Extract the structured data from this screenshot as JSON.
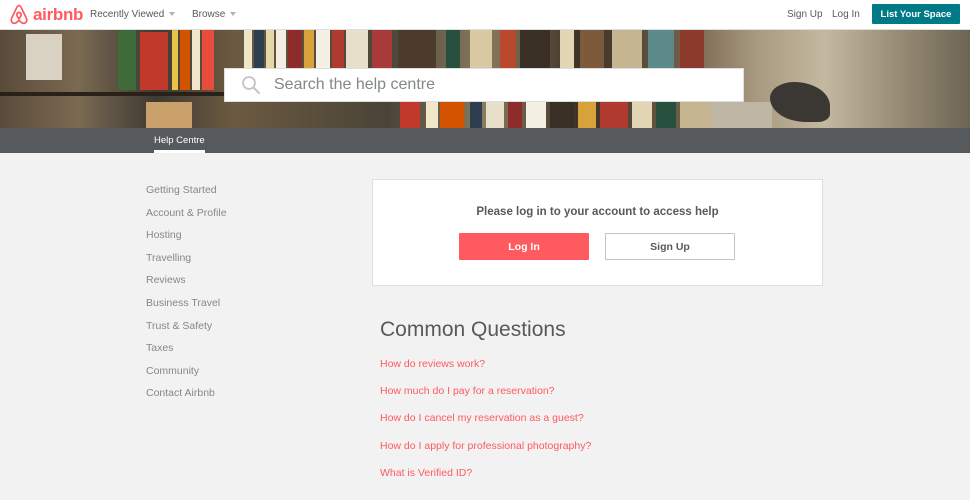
{
  "brand": {
    "name": "airbnb",
    "color": "#ff5a5f"
  },
  "header": {
    "recently_viewed": "Recently Viewed",
    "browse": "Browse",
    "sign_up": "Sign Up",
    "log_in": "Log In",
    "list_space": "List Your Space",
    "accent": "#007a87"
  },
  "search": {
    "placeholder": "Search the help centre",
    "icon": "search-icon"
  },
  "subnav": {
    "tab": "Help Centre"
  },
  "sidebar": {
    "items": [
      {
        "label": "Getting Started"
      },
      {
        "label": "Account & Profile"
      },
      {
        "label": "Hosting"
      },
      {
        "label": "Travelling"
      },
      {
        "label": "Reviews"
      },
      {
        "label": "Business Travel"
      },
      {
        "label": "Trust & Safety"
      },
      {
        "label": "Taxes"
      },
      {
        "label": "Community"
      },
      {
        "label": "Contact Airbnb"
      }
    ]
  },
  "login_card": {
    "message": "Please log in to your account to access help",
    "log_in": "Log In",
    "sign_up": "Sign Up"
  },
  "common_questions": {
    "title": "Common Questions",
    "items": [
      {
        "label": "How do reviews work?"
      },
      {
        "label": "How much do I pay for a reservation?"
      },
      {
        "label": "How do I cancel my reservation as a guest?"
      },
      {
        "label": "How do I apply for professional photography?"
      },
      {
        "label": "What is Verified ID?"
      }
    ]
  }
}
